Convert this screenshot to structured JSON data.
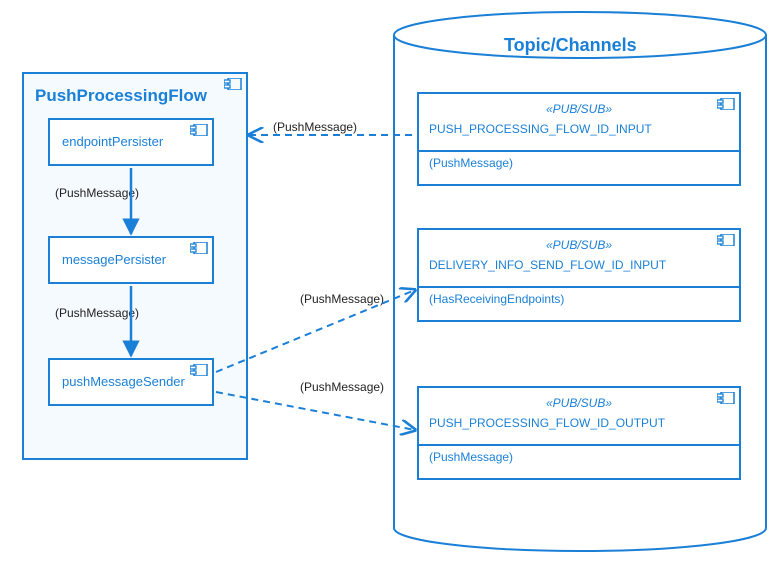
{
  "chart_data": {
    "type": "uml-component-diagram",
    "packages": [
      {
        "name": "PushProcessingFlow",
        "components": [
          {
            "name": "endpointPersister"
          },
          {
            "name": "messagePersister"
          },
          {
            "name": "pushMessageSender"
          }
        ]
      },
      {
        "name": "Topic/Channels",
        "shape": "datastore",
        "components": [
          {
            "stereotype": "«PUB/SUB»",
            "name": "PUSH_PROCESSING_FLOW_ID_INPUT",
            "payload": "(PushMessage)"
          },
          {
            "stereotype": "«PUB/SUB»",
            "name": "DELIVERY_INFO_SEND_FLOW_ID_INPUT",
            "payload": "(HasReceivingEndpoints)"
          },
          {
            "stereotype": "«PUB/SUB»",
            "name": "PUSH_PROCESSING_FLOW_ID_OUTPUT",
            "payload": "(PushMessage)"
          }
        ]
      }
    ],
    "edges": [
      {
        "from": "endpointPersister",
        "to": "messagePersister",
        "label": "(PushMessage)",
        "style": "solid-arrow"
      },
      {
        "from": "messagePersister",
        "to": "pushMessageSender",
        "label": "(PushMessage)",
        "style": "solid-arrow"
      },
      {
        "from": "endpointPersister",
        "to": "PUSH_PROCESSING_FLOW_ID_INPUT",
        "label": "(PushMessage)",
        "style": "dashed-arrow-reverse"
      },
      {
        "from": "pushMessageSender",
        "to": "DELIVERY_INFO_SEND_FLOW_ID_INPUT",
        "label": "(PushMessage)",
        "style": "dashed-arrow"
      },
      {
        "from": "pushMessageSender",
        "to": "PUSH_PROCESSING_FLOW_ID_OUTPUT",
        "label": "(PushMessage)",
        "style": "dashed-arrow"
      }
    ]
  },
  "labels": {
    "pkg_flow": "PushProcessingFlow",
    "pkg_topics": "Topic/Channels",
    "comp_endpoint": "endpointPersister",
    "comp_message": "messagePersister",
    "comp_sender": "pushMessageSender",
    "stereo_pubsub": "«PUB/SUB»",
    "topic_input": "PUSH_PROCESSING_FLOW_ID_INPUT",
    "topic_delivery": "DELIVERY_INFO_SEND_FLOW_ID_INPUT",
    "topic_output": "PUSH_PROCESSING_FLOW_ID_OUTPUT",
    "payload_push": "(PushMessage)",
    "payload_has": "(HasReceivingEndpoints)",
    "edge_push": "(PushMessage)"
  }
}
